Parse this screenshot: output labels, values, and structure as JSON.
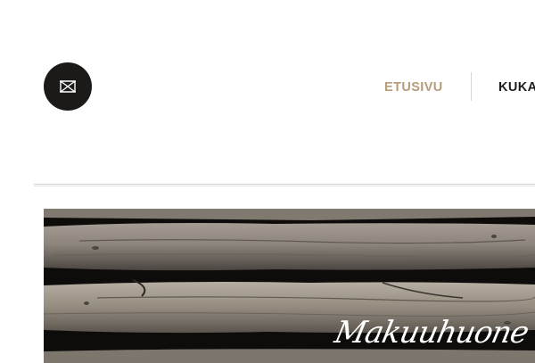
{
  "header": {
    "logo": {
      "icon": "hourglass-monogram-icon",
      "background": "#1c1a19",
      "color": "#ffffff"
    },
    "nav": {
      "items": [
        {
          "label": "ETUSIVU",
          "active": true,
          "color": "#b59c7a"
        },
        {
          "label": "KUKA",
          "active": false,
          "color": "#1d1d1d"
        }
      ]
    }
  },
  "hero": {
    "image": "weathered-log-wall",
    "script_text": "Makuuhuone"
  }
}
